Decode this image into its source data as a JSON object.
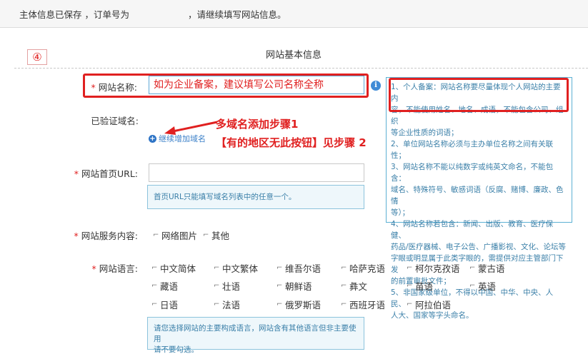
{
  "banner": {
    "text_before": "主体信息已保存 ，订单号为",
    "text_after": "，请继续填写网站信息。"
  },
  "step_marker": "④",
  "section_title": "网站基本信息",
  "form": {
    "required_mark": "*",
    "site_name": {
      "label": "网站名称:",
      "value": "如为企业备案，建议填写公司名称全称"
    },
    "verified_domain": {
      "label": "已验证域名:",
      "add_link": "继续增加域名"
    },
    "homepage_url": {
      "label": "网站首页URL:",
      "value": "",
      "hint": "首页URL只能填写域名列表中的任意一个。"
    },
    "service_content": {
      "label": "网站服务内容:",
      "options": [
        "网络图片",
        "其他"
      ]
    },
    "language": {
      "label": "网站语言:",
      "rows": [
        [
          "中文简体",
          "中文繁体",
          "维吾尔语",
          "哈萨克语",
          "柯尔克孜语",
          "蒙古语"
        ],
        [
          "藏语",
          "壮语",
          "朝鲜语",
          "彝文",
          "苗语",
          "英语"
        ],
        [
          "日语",
          "法语",
          "俄罗斯语",
          "西班牙语",
          "阿拉伯语"
        ]
      ],
      "hint_lines": [
        "请您选择网站的主要构成语言，网站含有其他语言但非主要使用",
        "请不要勾选。"
      ]
    }
  },
  "info_icon": "i",
  "tips": [
    "1、个人备案：网站名称要尽量体现个人网站的主要内",
    "容，不能使用姓名、地名、成语，不能包含公司、组织",
    "等企业性质的词语；",
    "2、单位网站名称必须与主办单位名称之间有关联性；",
    "3、网站名称不能以纯数字或纯英文命名，不能包含：",
    "域名、特殊符号、敏感词语（反腐、赌博、廉政、色情",
    "等）；",
    "4、网站名称若包含：新闻、出版、教育、医疗保健、",
    "药品/医疗器械、电子公告、广播影视、文化、论坛等",
    "字眼或明显属于此类字眼的，需提供对应主管部门下发",
    "的前置审批文件；",
    "5、非国家级单位，不得以中国、中华、中央、人民、",
    "人大、国家等字头命名。"
  ],
  "annotations": {
    "step1": "多域名添加步骤1",
    "step2": "【有的地区无此按钮】见步骤 2"
  },
  "colors": {
    "annotation_red": "#e02020",
    "link_blue": "#3a7fc8",
    "tip_text": "#3a7fa8",
    "tip_border": "#5cb0d3"
  }
}
